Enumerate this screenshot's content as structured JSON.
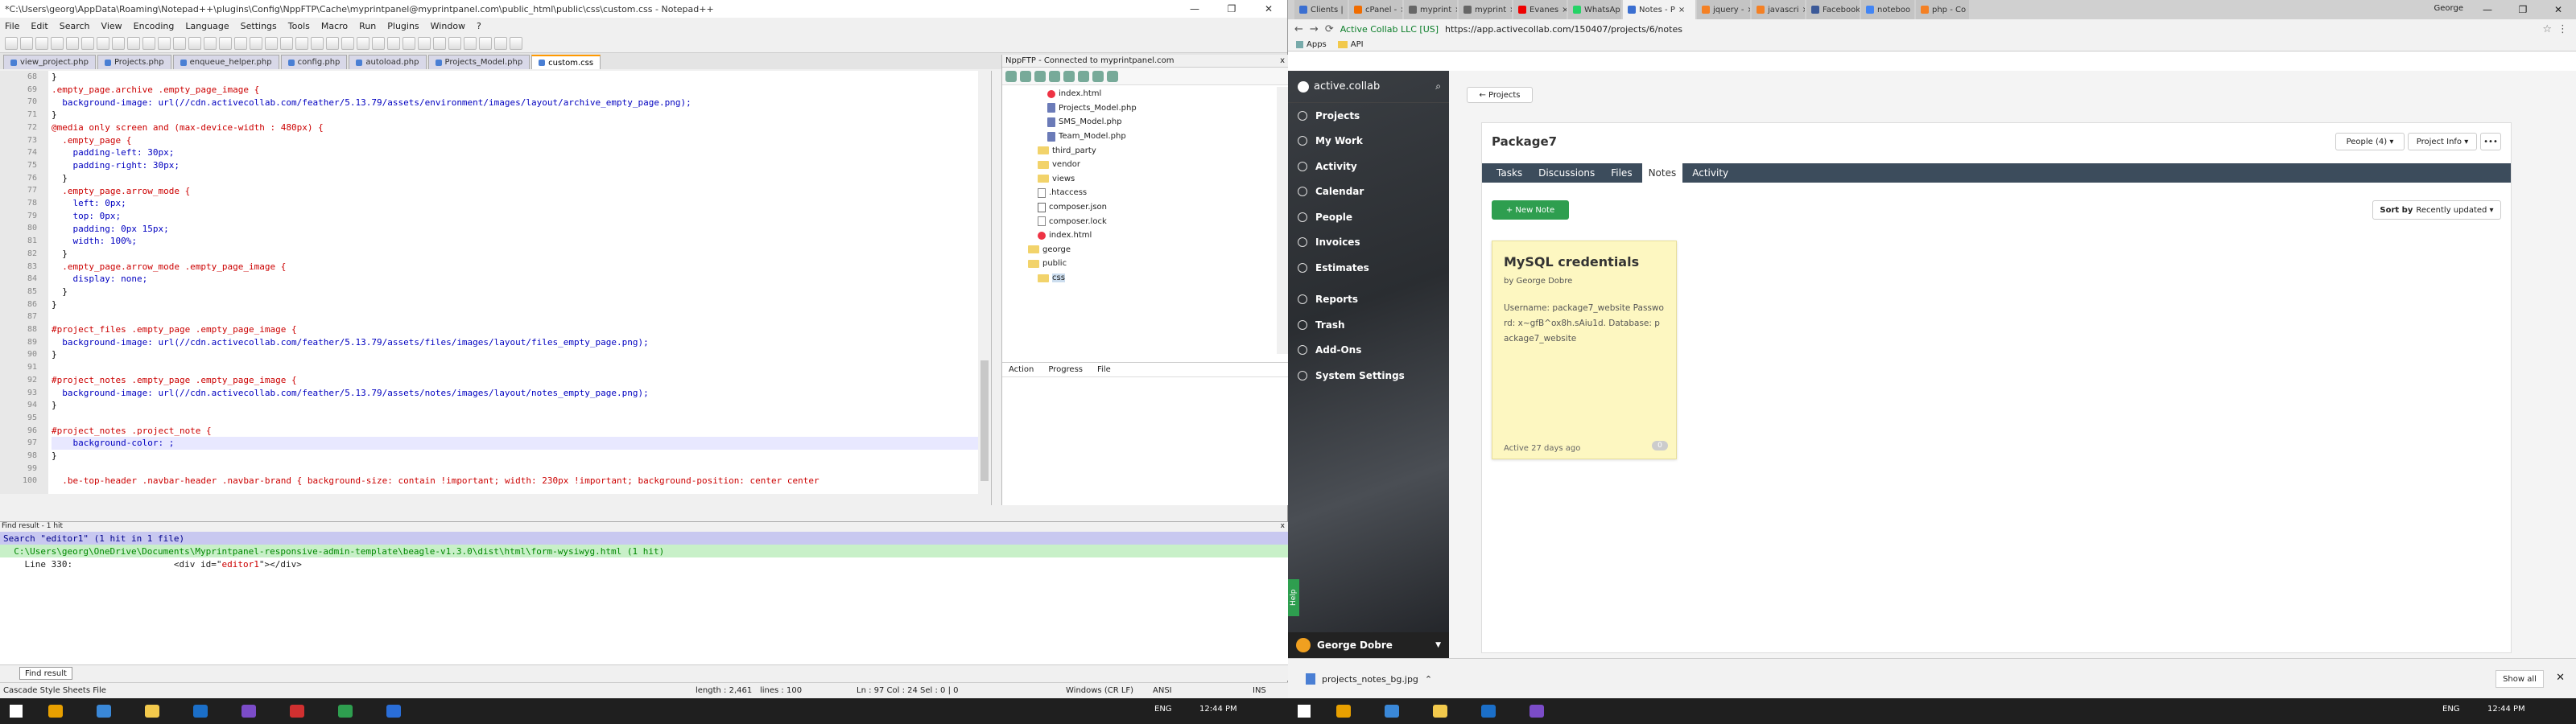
{
  "npp": {
    "title": "*C:\\Users\\georg\\AppData\\Roaming\\Notepad++\\plugins\\Config\\NppFTP\\Cache\\myprintpanel@myprintpanel.com\\public_html\\public\\css\\custom.css - Notepad++",
    "window_controls": [
      "—",
      "❐",
      "✕"
    ],
    "menu": [
      "File",
      "Edit",
      "Search",
      "View",
      "Encoding",
      "Language",
      "Settings",
      "Tools",
      "Macro",
      "Run",
      "Plugins",
      "Window",
      "?"
    ],
    "tabs": [
      "view_project.php",
      "Projects.php",
      "enqueue_helper.php",
      "config.php",
      "autoload.php",
      "Projects_Model.php",
      "custom.css"
    ],
    "active_tab": "custom.css",
    "code_lines": [
      {
        "n": "68",
        "text": "}"
      },
      {
        "n": "69",
        "text": ".empty_page.archive .empty_page_image {"
      },
      {
        "n": "70",
        "text": "  background-image: url(//cdn.activecollab.com/feather/5.13.79/assets/environment/images/layout/archive_empty_page.png);"
      },
      {
        "n": "71",
        "text": "}"
      },
      {
        "n": "72",
        "text": "@media only screen and (max-device-width : 480px) {"
      },
      {
        "n": "73",
        "text": "  .empty_page {"
      },
      {
        "n": "74",
        "text": "    padding-left: 30px;"
      },
      {
        "n": "75",
        "text": "    padding-right: 30px;"
      },
      {
        "n": "76",
        "text": "  }"
      },
      {
        "n": "77",
        "text": "  .empty_page.arrow_mode {"
      },
      {
        "n": "78",
        "text": "    left: 0px;"
      },
      {
        "n": "79",
        "text": "    top: 0px;"
      },
      {
        "n": "80",
        "text": "    padding: 0px 15px;"
      },
      {
        "n": "81",
        "text": "    width: 100%;"
      },
      {
        "n": "82",
        "text": "  }"
      },
      {
        "n": "83",
        "text": "  .empty_page.arrow_mode .empty_page_image {"
      },
      {
        "n": "84",
        "text": "    display: none;"
      },
      {
        "n": "85",
        "text": "  }"
      },
      {
        "n": "86",
        "text": "}"
      },
      {
        "n": "87",
        "text": ""
      },
      {
        "n": "88",
        "text": "#project_files .empty_page .empty_page_image {"
      },
      {
        "n": "89",
        "text": "  background-image: url(//cdn.activecollab.com/feather/5.13.79/assets/files/images/layout/files_empty_page.png);"
      },
      {
        "n": "90",
        "text": "}"
      },
      {
        "n": "91",
        "text": ""
      },
      {
        "n": "92",
        "text": "#project_notes .empty_page .empty_page_image {"
      },
      {
        "n": "93",
        "text": "  background-image: url(//cdn.activecollab.com/feather/5.13.79/assets/notes/images/layout/notes_empty_page.png);"
      },
      {
        "n": "94",
        "text": "}"
      },
      {
        "n": "95",
        "text": ""
      },
      {
        "n": "96",
        "text": "#project_notes .project_note {"
      },
      {
        "n": "97",
        "text": "    background-color: ;"
      },
      {
        "n": "98",
        "text": "}"
      },
      {
        "n": "99",
        "text": ""
      },
      {
        "n": "100",
        "text": "  .be-top-header .navbar-header .navbar-brand { background-size: contain !important; width: 230px !important; background-position: center center"
      }
    ],
    "ftp": {
      "title": "NppFTP - Connected to myprintpanel.com",
      "close": "x",
      "tree": [
        {
          "label": "index.html",
          "icon": "html",
          "indent": 2
        },
        {
          "label": "Projects_Model.php",
          "icon": "php",
          "indent": 2
        },
        {
          "label": "SMS_Model.php",
          "icon": "php",
          "indent": 2
        },
        {
          "label": "Team_Model.php",
          "icon": "php",
          "indent": 2
        },
        {
          "label": "third_party",
          "icon": "folder",
          "indent": 1
        },
        {
          "label": "vendor",
          "icon": "folder",
          "indent": 1
        },
        {
          "label": "views",
          "icon": "folder",
          "indent": 1
        },
        {
          "label": ".htaccess",
          "icon": "file",
          "indent": 1
        },
        {
          "label": "composer.json",
          "icon": "json",
          "indent": 1
        },
        {
          "label": "composer.lock",
          "icon": "file",
          "indent": 1
        },
        {
          "label": "index.html",
          "icon": "html",
          "indent": 1
        },
        {
          "label": "george",
          "icon": "folder",
          "indent": 0
        },
        {
          "label": "public",
          "icon": "folder",
          "indent": 0
        },
        {
          "label": "css",
          "icon": "folder",
          "indent": 1,
          "selected": true
        }
      ],
      "log_columns": [
        "Action",
        "Progress",
        "File"
      ]
    },
    "find": {
      "title": "Find result - 1 hit",
      "close": "x",
      "search_line": "Search \"editor1\" (1 hit in 1 file)",
      "file_line": "  C:\\Users\\georg\\OneDrive\\Documents\\Myprintpanel-responsive-admin-template\\beagle-v1.3.0\\dist\\html\\form-wysiwyg.html (1 hit)",
      "hit_prefix": "    Line 330:                   <div id=\"",
      "hit_word": "editor1",
      "hit_suffix": "\"></div>",
      "tab_label": "Find result"
    },
    "status": {
      "type": "Cascade Style Sheets File",
      "length": "length : 2,461",
      "lines": "lines : 100",
      "pos": "Ln : 97    Col : 24    Sel : 0 | 0",
      "eol": "Windows (CR LF)",
      "enc": "ANSI",
      "ins": "INS"
    }
  },
  "taskbar_left": {
    "tray_lang": "ENG",
    "time": "12:44 PM"
  },
  "taskbar_right": {
    "tray_lang": "ENG",
    "time": "12:44 PM"
  },
  "chrome": {
    "tabs": [
      {
        "label": "Clients |",
        "color": "#3b6fd1"
      },
      {
        "label": "cPanel -",
        "color": "#f06c00"
      },
      {
        "label": "myprint",
        "color": "#666"
      },
      {
        "label": "myprint",
        "color": "#666"
      },
      {
        "label": "Evanes",
        "color": "#e00"
      },
      {
        "label": "WhatsAp",
        "color": "#25d366"
      },
      {
        "label": "Notes - P",
        "color": "#3b6fd1",
        "active": true
      },
      {
        "label": "jquery -",
        "color": "#f48024"
      },
      {
        "label": "javascri",
        "color": "#f48024"
      },
      {
        "label": "Facebook",
        "color": "#3b5998"
      },
      {
        "label": "noteboo",
        "color": "#4285f4"
      },
      {
        "label": "php - Co",
        "color": "#f48024"
      }
    ],
    "user": "George",
    "window_controls": [
      "—",
      "❐",
      "✕"
    ],
    "site_name": "Active Collab LLC [US]",
    "url": "https://app.activecollab.com/150407/projects/6/notes",
    "bookmarks": [
      "Apps",
      "API"
    ],
    "download_file": "projects_notes_bg.jpg",
    "show_all": "Show all"
  },
  "ac": {
    "logo": "active.collab",
    "nav": [
      "Projects",
      "My Work",
      "Activity",
      "Calendar",
      "People",
      "Invoices",
      "Estimates",
      "Reports",
      "Trash",
      "Add-Ons",
      "System Settings"
    ],
    "help": "Help",
    "user": "George Dobre",
    "back": "← Projects",
    "project_title": "Package7",
    "people_btn": "People (4) ▾",
    "info_btn": "Project Info ▾",
    "more_btn": "•••",
    "tabs": [
      "Tasks",
      "Discussions",
      "Files",
      "Notes",
      "Activity"
    ],
    "active_tab": "Notes",
    "new_note": "+ New Note",
    "sort_label": "Sort by",
    "sort_value": "Recently updated ▾",
    "note": {
      "title": "MySQL credentials",
      "by": "by George Dobre",
      "body": "Username: package7_website Password: x~gfB^ox8h.sAiu1d. Database: package7_website",
      "footer": "Active 27 days ago",
      "count": "0"
    }
  }
}
